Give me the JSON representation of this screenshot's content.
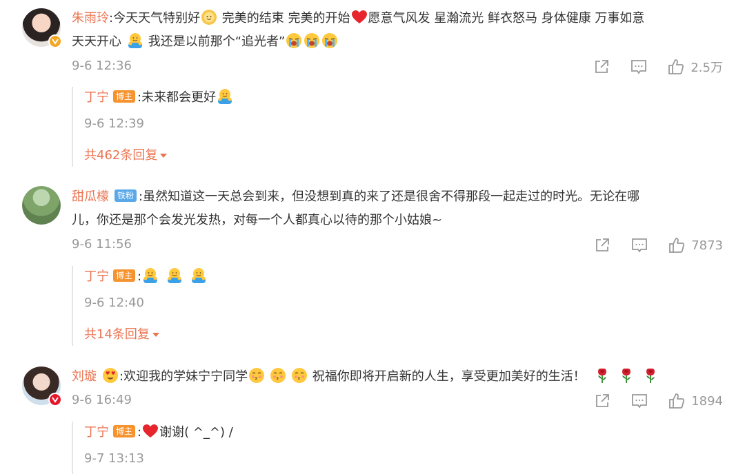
{
  "comments": [
    {
      "name": "朱雨玲",
      "text_1": ":今天天气特别好",
      "text_2": " 完美的结束 完美的开始",
      "text_3": "愿意气风发 星瀚流光 鲜衣怒马 身体健康 万事如意",
      "text_4": "天天开心",
      "text_5": " 我还是以前那个“追光者”",
      "time": "9-6 12:36",
      "likes": "2.5万",
      "reply": {
        "name": "丁宁",
        "badge": "博主",
        "text": ":未来都会更好",
        "time": "9-6 12:39",
        "more": "共462条回复"
      }
    },
    {
      "name": "甜瓜檬",
      "badge": "铁粉",
      "text_1": ":虽然知道这一天总会到来，但没想到真的来了还是很舍不得那段一起走过的时光。无论在哪",
      "text_2": "儿，你还是那个会发光发热，对每一个人都真心以待的那个小姑娘~",
      "time": "9-6 11:56",
      "likes": "7873",
      "reply": {
        "name": "丁宁",
        "badge": "博主",
        "text": ":",
        "time": "9-6 12:40",
        "more": "共14条回复"
      }
    },
    {
      "name": "刘璇",
      "text_1": ":欢迎我的学妹宁宁同学",
      "text_2": " 祝福你即将开启新的人生，享受更加美好的生活！",
      "time": "9-6 16:49",
      "likes": "1894",
      "reply": {
        "name": "丁宁",
        "badge": "博主",
        "text": "谢谢( ^_^) /",
        "time": "9-7 13:13"
      }
    }
  ],
  "icons": {
    "share": "share-icon",
    "comment": "comment-icon",
    "like": "thumbs-up-icon",
    "dropdown": "caret-down-icon"
  },
  "colors": {
    "name": "#eb7350",
    "meta": "#999999",
    "badge_blogger": "#f7932f",
    "badge_fan": "#5aa8e8",
    "verified": "#f5a623",
    "verified_red": "#e6162d"
  }
}
